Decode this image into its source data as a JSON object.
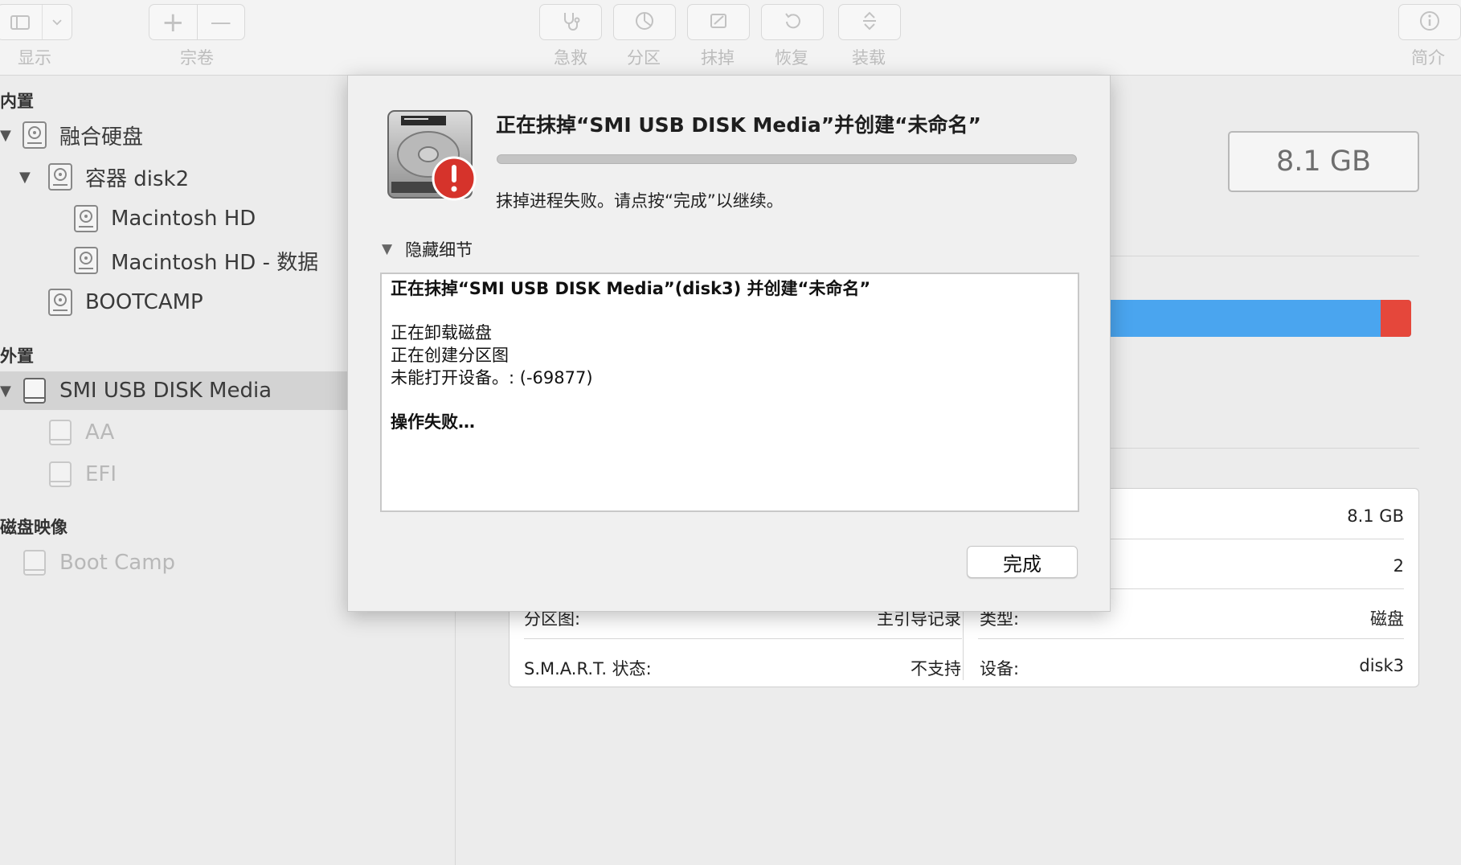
{
  "toolbar": {
    "view_label": "显示",
    "volume_label": "宗卷",
    "first_aid_label": "急救",
    "partition_label": "分区",
    "erase_label": "抹掉",
    "restore_label": "恢复",
    "mount_label": "装载",
    "info_label": "简介",
    "volume_add_glyph": "+",
    "volume_remove_glyph": "—"
  },
  "sidebar": {
    "internal_header": "内置",
    "external_header": "外置",
    "images_header": "磁盘映像",
    "items": [
      {
        "label": "融合硬盘",
        "icon": "internal-disk-icon",
        "state": "normal"
      },
      {
        "label": "容器 disk2",
        "icon": "internal-disk-icon",
        "state": "normal"
      },
      {
        "label": "Macintosh HD",
        "icon": "internal-disk-icon",
        "state": "normal"
      },
      {
        "label": "Macintosh HD - 数据",
        "icon": "internal-disk-icon",
        "state": "normal"
      },
      {
        "label": "BOOTCAMP",
        "icon": "internal-disk-icon",
        "state": "normal"
      },
      {
        "label": "SMI USB DISK Media",
        "icon": "external-disk-icon",
        "state": "selected"
      },
      {
        "label": "AA",
        "icon": "volume-icon",
        "state": "dimmed"
      },
      {
        "label": "EFI",
        "icon": "volume-icon",
        "state": "dimmed"
      },
      {
        "label": "Boot Camp",
        "icon": "disk-image-icon",
        "state": "dimmed"
      }
    ]
  },
  "main": {
    "capacity": "8.1 GB",
    "usage": {
      "used_color": "#4aa5ef",
      "other_color": "#e5473b"
    },
    "info": {
      "row1_right_value": "8.1 GB",
      "row2_right_value": "2",
      "partition_map_label": "分区图:",
      "partition_map_value": "主引导记录",
      "type_label": "类型:",
      "type_value": "磁盘",
      "smart_label": "S.M.A.R.T. 状态:",
      "smart_value": "不支持",
      "device_label": "设备:",
      "device_value": "disk3"
    }
  },
  "dialog": {
    "title": "正在抹掉“SMI USB DISK Media”并创建“未命名”",
    "message": "抹掉进程失败。请点按“完成”以继续。",
    "details_toggle": "隐藏细节",
    "log": {
      "line1": "正在抹掉“SMI USB DISK Media”(disk3) 并创建“未命名”",
      "line2": "正在卸载磁盘",
      "line3": "正在创建分区图",
      "line4": "未能打开设备。: (-69877)",
      "line5": "操作失败…"
    },
    "done_button": "完成",
    "icon": "hard-drive-error-icon",
    "alert_color": "#d6332b"
  }
}
